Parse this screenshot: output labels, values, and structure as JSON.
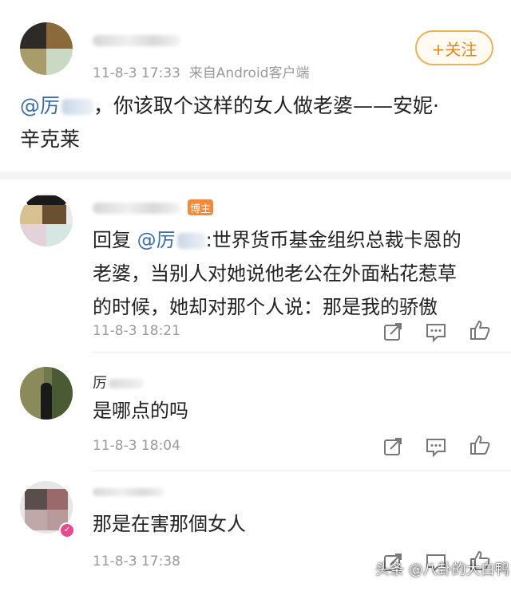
{
  "post": {
    "time": "11-8-3 17:33",
    "source": "来自Android客户端",
    "follow_label": "+关注",
    "mention": "@厉",
    "text_line1": "，你该取个这样的女人做老婆——安妮·",
    "text_line2": "辛克莱"
  },
  "replies": [
    {
      "badge": "博主",
      "reply_prefix": "回复",
      "mention": "@厉",
      "line1": ":世界货币基金组织总裁卡恩的",
      "line2": "老婆，当别人对她说他老公在外面粘花惹草",
      "line3": "的时候，她却对那个人说：那是我的骄傲",
      "time": "11-8-3 18:21"
    },
    {
      "name": "厉",
      "text": "是哪点的吗",
      "time": "11-8-3 18:04"
    },
    {
      "text": "那是在害那個女人",
      "time": "11-8-3 17:38"
    }
  ],
  "icons": [
    "share-icon",
    "comment-icon",
    "like-icon"
  ],
  "watermark": "头条 @八卦的大白鸭",
  "colors": {
    "accent": "#e08a1e",
    "link": "#3b6ea5",
    "badge": "#f28a3b",
    "meta": "#9a9a9a"
  }
}
